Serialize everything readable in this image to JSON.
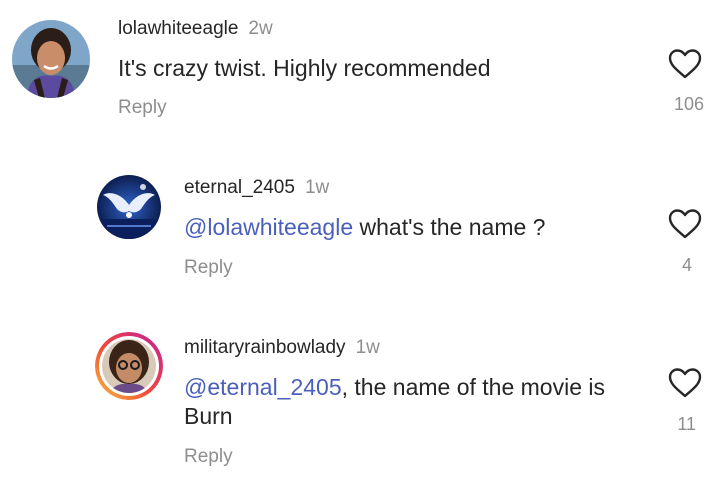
{
  "comments": [
    {
      "username": "lolawhiteeagle",
      "time": "2w",
      "text": "It's crazy twist. Highly recommended",
      "reply_label": "Reply",
      "likes": "106",
      "avatar_icon": "user-photo-avatar"
    },
    {
      "username": "eternal_2405",
      "time": "1w",
      "mention": "@lolawhiteeagle",
      "text": " what's the name ?",
      "reply_label": "Reply",
      "likes": "4",
      "avatar_icon": "wings-logo-avatar"
    },
    {
      "username": "militaryrainbowlady",
      "time": "1w",
      "mention": "@eternal_2405",
      "text": ", the name of the movie is Burn",
      "reply_label": "Reply",
      "likes": "11",
      "avatar_icon": "story-ring-avatar"
    }
  ],
  "colors": {
    "mention": "#4a5fbb",
    "secondary_text": "#8e8e8e",
    "primary_text": "#262626"
  }
}
